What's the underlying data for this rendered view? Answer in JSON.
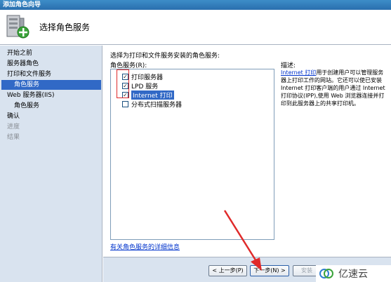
{
  "window": {
    "title": "添加角色向导"
  },
  "header": {
    "title": "选择角色服务",
    "icon": "server-add-icon"
  },
  "sidebar": {
    "items": [
      {
        "label": "开始之前",
        "state": "normal"
      },
      {
        "label": "服务器角色",
        "state": "normal"
      },
      {
        "label": "打印和文件服务",
        "state": "normal"
      },
      {
        "label": "角色服务",
        "state": "active"
      },
      {
        "label": "Web 服务器(IIS)",
        "state": "normal"
      },
      {
        "label": "角色服务",
        "state": "normal"
      },
      {
        "label": "确认",
        "state": "normal"
      },
      {
        "label": "进度",
        "state": "dim"
      },
      {
        "label": "结果",
        "state": "dim"
      }
    ]
  },
  "main": {
    "instruction": "选择为打印和文件服务安装的角色服务:",
    "roles_label": "角色服务(R):",
    "role_services": [
      {
        "label": "打印服务器",
        "checked": true,
        "selected": false
      },
      {
        "label": "LPD 服务",
        "checked": true,
        "selected": false
      },
      {
        "label": "Internet 打印",
        "checked": true,
        "selected": true
      },
      {
        "label": "分布式扫描服务器",
        "checked": false,
        "selected": false
      }
    ],
    "more_info_link": "有关角色服务的详细信息"
  },
  "description": {
    "label": "描述:",
    "link": "Internet 打印",
    "text": "用于创建用户可以管理服务器上打印工作的网站。它还可以使已安装 Internet 打印客户端的用户通过 Internet 打印协议(IPP),使用 Web 浏览器连接并打印到此服务器上的共享打印机。"
  },
  "footer": {
    "back": "< 上一步(P)",
    "next": "下一步(N) >",
    "install": "安装"
  },
  "watermark": {
    "text": "亿速云"
  },
  "colors": {
    "accent": "#3169c6",
    "annotation": "#e02a2a",
    "sidebar_bg": "#d9e3ef"
  }
}
